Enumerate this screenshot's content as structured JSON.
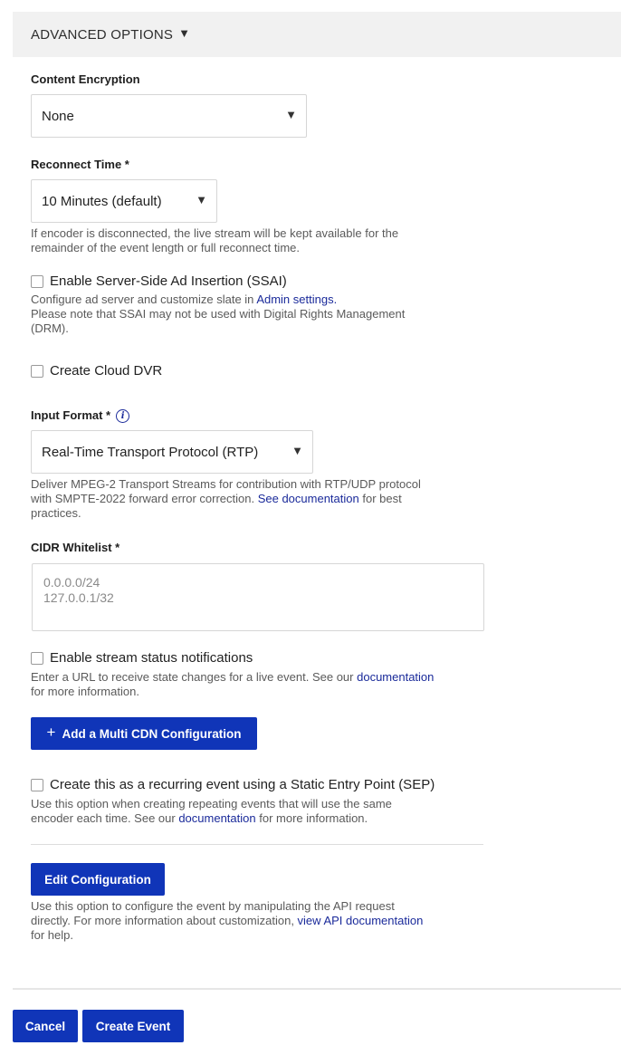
{
  "advanced": {
    "title": "ADVANCED OPTIONS",
    "caret": "▼"
  },
  "encryption": {
    "label": "Content Encryption",
    "value": "None",
    "arrow": "▼"
  },
  "reconnect": {
    "label": "Reconnect Time *",
    "value": "10 Minutes (default)",
    "arrow": "▼",
    "help_line1": "If encoder is disconnected, the live stream will be kept available for the",
    "help_line2": "remainder of the event length or full reconnect time."
  },
  "ssai": {
    "label": "Enable Server-Side Ad Insertion (SSAI)",
    "help_prefix": "Configure ad server and customize slate in ",
    "help_link": "Admin settings.",
    "help_line2": "Please note that SSAI may not be used with Digital Rights Management",
    "help_line3": "(DRM)."
  },
  "dvr": {
    "label": "Create Cloud DVR"
  },
  "input_format": {
    "label": "Input Format *",
    "info_glyph": "i",
    "value": "Real-Time Transport Protocol (RTP)",
    "arrow": "▼",
    "help_line1": "Deliver MPEG-2 Transport Streams for contribution with RTP/UDP protocol",
    "help_line2_prefix": "with SMPTE-2022 forward error correction. ",
    "help_link": "See documentation",
    "help_line2_suffix": " for best",
    "help_line3": "practices."
  },
  "cidr": {
    "label": "CIDR Whitelist *",
    "placeholder_line1": "0.0.0.0/24",
    "placeholder_line2": "127.0.0.1/32"
  },
  "notifications": {
    "label": "Enable stream status notifications",
    "help_prefix": "Enter a URL to receive state changes for a live event. See our ",
    "help_link": "documentation",
    "help_line2": "for more information."
  },
  "multi_cdn": {
    "plus": "+",
    "label": "Add a Multi CDN Configuration"
  },
  "sep": {
    "label": "Create this as a recurring event using a Static Entry Point (SEP)",
    "help_line1": "Use this option when creating repeating events that will use the same",
    "help_line2_prefix": "encoder each time. See our ",
    "help_link": "documentation",
    "help_line2_suffix": " for more information."
  },
  "edit_config": {
    "label": "Edit Configuration",
    "help_line1": "Use this option to configure the event by manipulating the API request",
    "help_line2_prefix": "directly. For more information about customization, ",
    "help_link": "view API documentation",
    "help_line3": "for help."
  },
  "footer": {
    "cancel": "Cancel",
    "create": "Create Event"
  }
}
